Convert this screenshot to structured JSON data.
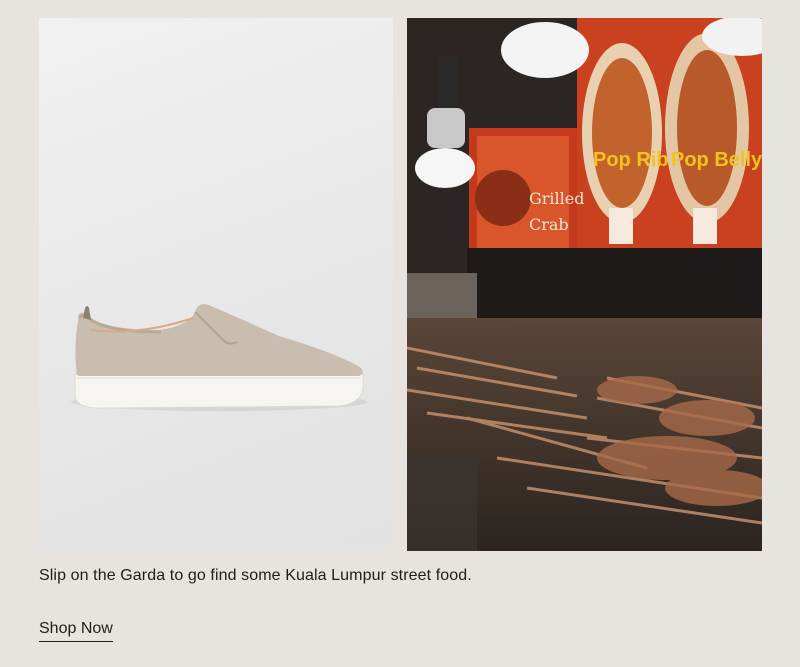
{
  "promo": {
    "images": [
      {
        "icon": "slip-on-sneaker-icon"
      },
      {
        "icon": "street-food-stall-icon",
        "signs": [
          "Pop Rib",
          "Pop Belly",
          "Grilled",
          "Crab"
        ]
      }
    ],
    "caption": "Slip on the Garda to go find some Kuala Lumpur street food.",
    "cta_label": "Shop Now"
  },
  "colors": {
    "background": "#e7e3df",
    "text": "#1e1e1e"
  }
}
